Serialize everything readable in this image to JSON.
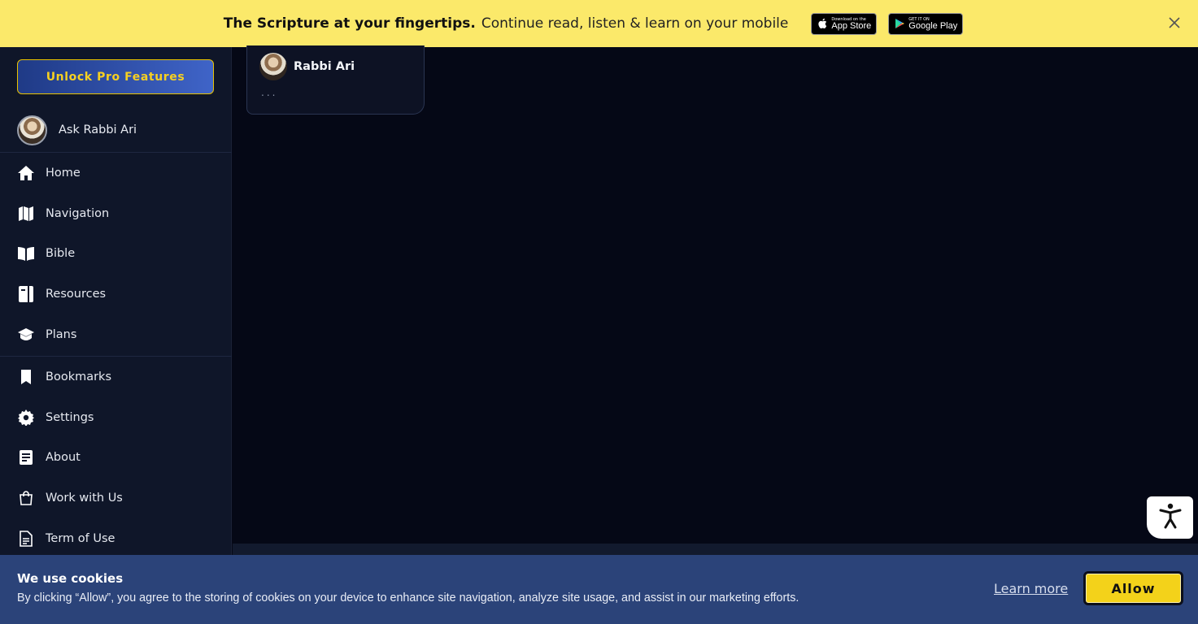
{
  "promo": {
    "bold": "The Scripture at your fingertips.",
    "text": "Continue read, listen & learn on your mobile",
    "app_store": {
      "small": "Download on the",
      "big": "App Store"
    },
    "google_play": {
      "small": "GET IT ON",
      "big": "Google Play"
    }
  },
  "sidebar": {
    "unlock": "Unlock Pro Features",
    "ask": "Ask Rabbi Ari",
    "items": [
      {
        "label": "Home",
        "icon": "home-icon"
      },
      {
        "label": "Navigation",
        "icon": "map-icon"
      },
      {
        "label": "Bible",
        "icon": "book-open-icon"
      },
      {
        "label": "Resources",
        "icon": "resources-icon"
      },
      {
        "label": "Plans",
        "icon": "graduation-cap-icon"
      }
    ],
    "items2": [
      {
        "label": "Bookmarks",
        "icon": "bookmark-icon"
      },
      {
        "label": "Settings",
        "icon": "gear-icon"
      },
      {
        "label": "About",
        "icon": "document-icon"
      },
      {
        "label": "Work with Us",
        "icon": "shopping-bag-icon"
      },
      {
        "label": "Term of Use",
        "icon": "file-text-icon"
      }
    ]
  },
  "chat": {
    "name": "Rabbi Ari",
    "typing": "..."
  },
  "cookie": {
    "title": "We use cookies",
    "text": "By clicking “Allow”, you agree to the storing of cookies on your device to enhance site navigation, analyze site usage, and assist in our marketing efforts.",
    "learn": "Learn more",
    "allow": "Allow"
  },
  "colors": {
    "banner": "#fbe96a",
    "sidebar": "#0f1629",
    "main": "#050816",
    "cookie": "#2b4379",
    "accent": "#f3d21a"
  }
}
